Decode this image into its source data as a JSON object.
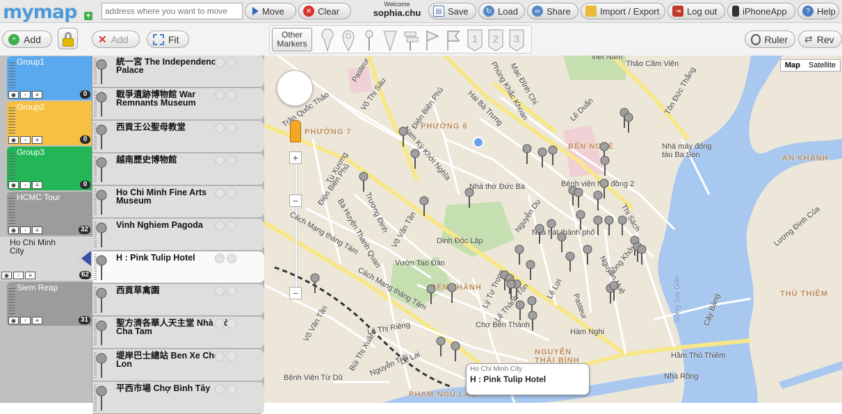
{
  "header": {
    "logo": "mymap",
    "logo_plus": "+",
    "address_placeholder": "address where you want to move",
    "move_label": "Move",
    "clear_label": "Clear",
    "welcome_label": "Welcome",
    "username": "sophia.chu",
    "save_label": "Save",
    "load_label": "Load",
    "share_label": "Share",
    "import_export_label": "Import / Export",
    "logout_label": "Log out",
    "iphoneapp_label": "iPhoneApp",
    "help_label": "Help"
  },
  "toolbar": {
    "add_label": "Add",
    "remove_add_label": "Add",
    "fit_label": "Fit",
    "other_markers_label": "Other Markers",
    "marker_numbers": [
      "1",
      "2",
      "3"
    ],
    "ruler_label": "Ruler",
    "rev_label": "Rev"
  },
  "groups": [
    {
      "name": "Group1",
      "count": "0",
      "color": "#5aa9ee"
    },
    {
      "name": "Group2",
      "count": "0",
      "color": "#f6c040"
    },
    {
      "name": "Group3",
      "count": "0",
      "color": "#22b657"
    },
    {
      "name": "HCMC Tour",
      "count": "32",
      "color": "#9c9c9c"
    },
    {
      "name": "Ho Chi Minh City",
      "count": "62",
      "color": "#d8d8d8"
    },
    {
      "name": "Siem Reap",
      "count": "31",
      "color": "#9c9c9c"
    }
  ],
  "places": [
    "統一宮 The Independence Palace",
    "戰爭遺跡博物館 War Remnants Museum",
    "西貢王公聖母教堂",
    "越南歷史博物館",
    "Ho Chi Minh Fine Arts Museum",
    "Vinh Nghiem Pagoda",
    "H : Pink Tulip Hotel",
    "西貢草禽園",
    "聖方濟各華人天主堂 Nhà thờ Cha Tam",
    "堤岸巴士總站 Ben Xe Cho Lon",
    "平西市場 Chợ Bình Tây"
  ],
  "map": {
    "type_map": "Map",
    "type_satellite": "Satellite",
    "zoom_in": "+",
    "zoom_out": "−",
    "labels": {
      "phuong7": "PHƯỜNG 7",
      "phuong6": "PHƯỜNG 6",
      "ben_nghe": "BẾN NGHÉ",
      "ben_thanh": "BẾN THÀNH",
      "pham_ngu_lao": "PHẠM NGŨ LÃO",
      "nguyen_thai_binh": "NGUYỄN THÁI BÌNH",
      "an_khanh": "AN KHÁNH",
      "thu_thiem": "THỦ THIÊM",
      "song_sai_gon": "Sông Sài Gòn",
      "thao_cam_vien": "Thảo Cầm Viên",
      "nha_may_dong": "Nhà máy đóng tàu Ba Son",
      "nha_tho": "Nhà thờ Đức Bà",
      "benh_vien_nhi": "Bệnh viện Nhi đồng 2",
      "dinh_doc_lap": "Dinh Độc Lập",
      "nha_hat": "Nhà hát thành phố",
      "vuon_tao_dan": "Vườn Tao Đàn",
      "cho_ben_thanh": "Chợ Bến Thành",
      "ham_nghi": "Hàm Nghi",
      "nha_rong": "Nhà Rồng",
      "ham_thu_thiem": "Hầm Thủ Thiêm",
      "benh_vien_tu_du": "Bệnh Viện Từ Dũ",
      "cach_mang": "Cách Mạng tháng Tám",
      "nam_ky": "Nam Kỳ Khởi Nghĩa",
      "hai_ba_trung": "Hai Bà Trưng",
      "le_duan": "Lê Duẩn",
      "dien_bien_phu": "Điện Biên Phủ",
      "vo_thi_sau": "Võ Thị Sáu",
      "nguyen_trai": "Nguyễn Trãi",
      "le_lai": "Lê Lai",
      "le_loi": "Lê Lợi",
      "dong_khoi": "Đồng Khởi",
      "tran_quoc_thao": "Trần Quốc Thảo",
      "pasteur": "Pasteur",
      "ton_duc_thang": "Tôn Đức Thắng",
      "luong_dinh_cua": "Lương Đình Của",
      "cay_bang": "Cây Bàng",
      "viet_nam": "Việt Nam",
      "nguyen_hue": "Nguyễn Huệ",
      "ly_tu_trong": "Lý Tự Trọng",
      "le_thanh_ton": "Lê Thánh Tôn",
      "nguyen_du": "Nguyễn Du",
      "thi_sach": "Thi Sách",
      "tu_xuong": "Tú Xương",
      "vo_van_tan": "Võ Văn Tần",
      "truong_dinh": "Trương Định",
      "ba_huyen": "Bà Huyện Thanh Quan",
      "bui_thi_xuan": "Bùi Thị Xuân",
      "le_thi_rieng": "Lê Thị Riêng",
      "phung_khac_khoan": "Phùng Khắc Khoan",
      "mac_dinh_chi": "Mạc Đĩnh Chi"
    }
  },
  "infobox": {
    "subtitle": "Ho Chi Minh City",
    "title": "H : Pink Tulip Hotel"
  }
}
